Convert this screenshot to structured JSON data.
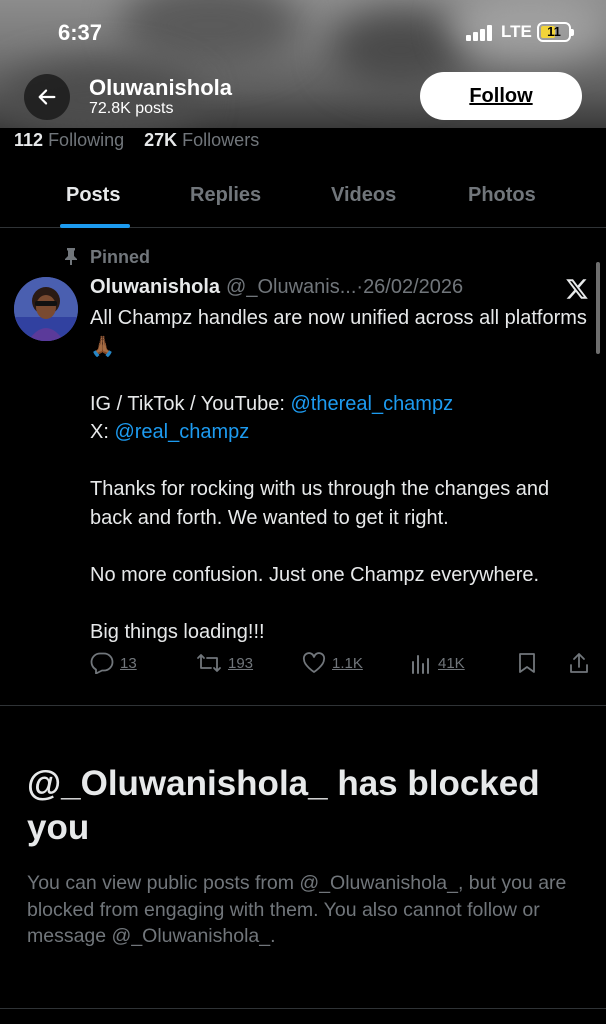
{
  "status_bar": {
    "time": "6:37",
    "network": "LTE",
    "battery": "11"
  },
  "header": {
    "name": "Oluwanishola",
    "posts": "72.8K posts",
    "follow_label": "Follow"
  },
  "stats": {
    "following_count": "112",
    "following_label": "Following",
    "followers_count": "27K",
    "followers_label": "Followers"
  },
  "tabs": [
    {
      "label": "Posts",
      "active": true
    },
    {
      "label": "Replies"
    },
    {
      "label": "Videos"
    },
    {
      "label": "Photos"
    }
  ],
  "post": {
    "pinned_label": "Pinned",
    "author": "Oluwanishola",
    "handle": "@_Oluwanis...",
    "separator": "·",
    "date": "26/02/2026",
    "line1": "All Champz handles are now unified across all platforms",
    "emoji": "🙏🏾",
    "ig_prefix": "IG / TikTok / YouTube: ",
    "ig_link": "@thereal_champz",
    "x_prefix": "X: ",
    "x_link": "@real_champz",
    "para2": "Thanks for rocking with us through the changes and back and forth. We wanted to get it right.",
    "para3": "No more confusion. Just one Champz everywhere.",
    "para4": "Big things loading!!!",
    "replies": "13",
    "reposts": "193",
    "likes": "1.1K",
    "views": "41K"
  },
  "blocked": {
    "title": "@_Oluwanishola_ has blocked you",
    "description": "You can view public posts from @_Oluwanishola_, but you are blocked from engaging with them. You also cannot follow or message @_Oluwanishola_."
  },
  "colors": {
    "accent": "#1d9bf0",
    "muted": "#71767b",
    "text": "#e7e9ea",
    "background": "#000000"
  }
}
